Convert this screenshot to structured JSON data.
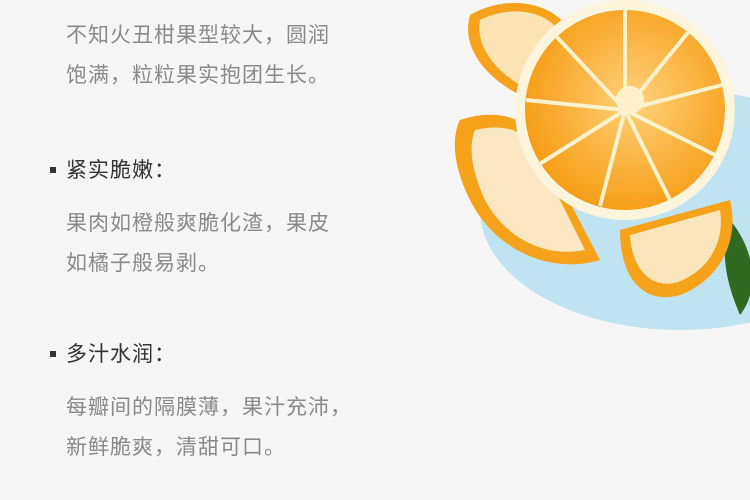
{
  "intro": {
    "line1": "不知火丑柑果型较大，圆润",
    "line2": "饱满，粒粒果实抱团生长。"
  },
  "features": [
    {
      "title": "紧实脆嫩：",
      "line1": "果肉如橙般爽脆化渣，果皮",
      "line2": "如橘子般易剥。"
    },
    {
      "title": "多汁水润：",
      "line1": "每瓣间的隔膜薄，果汁充沛，",
      "line2": "新鲜脆爽，清甜可口。"
    }
  ],
  "colors": {
    "background": "#f6f6f6",
    "heading_text": "#333333",
    "body_text": "#8a8a8a",
    "orange": "#f7a21b",
    "plate": "#bfe3f0"
  },
  "icons": [
    "square-bullet-icon"
  ]
}
